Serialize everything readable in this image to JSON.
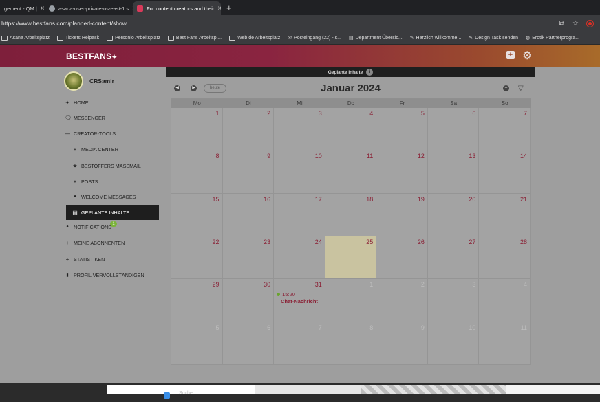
{
  "browser": {
    "tabs": [
      {
        "title": "gement - QM |",
        "color": "#6aa0ff"
      },
      {
        "title": "asana-user-private-us-east-1.s",
        "color": "#9aa0a6"
      },
      {
        "title": "For content creators and their",
        "color": "#d93a5a"
      }
    ],
    "url": "https://www.bestfans.com/planned-content/show",
    "bookmarks": [
      "Asana Arbeitsplatz",
      "Tickets Helpask",
      "Personio Arbeitsplatz",
      "Best Fans Arbeitspl...",
      "Web.de Arbeitsplatz",
      "Posteingang (22) - s...",
      "Department Übersic...",
      "Herzlich willkomme...",
      "Design Task senden",
      "Erotik Partnerprogra..."
    ]
  },
  "site": {
    "logo": "BESTFANS",
    "username": "CRSamir",
    "nav": [
      {
        "label": "HOME",
        "icon": "star-icon",
        "glyph": "✦"
      },
      {
        "label": "MESSENGER",
        "icon": "chat-icon",
        "glyph": "🗨"
      },
      {
        "label": "CREATOR-TOOLS",
        "icon": "minus-icon",
        "glyph": "—"
      },
      {
        "label": "MEDIA CENTER",
        "icon": "plus-icon",
        "glyph": "+"
      },
      {
        "label": "BESTOFFERS MASSMAIL",
        "icon": "star-icon",
        "glyph": "★"
      },
      {
        "label": "POSTS",
        "icon": "plus-icon",
        "glyph": "+"
      },
      {
        "label": "WELCOME MESSAGES",
        "icon": "speech-icon",
        "glyph": "●"
      },
      {
        "label": "GEPLANTE INHALTE",
        "icon": "calendar-icon",
        "glyph": "▤"
      },
      {
        "label": "NOTIFICATIONS",
        "icon": "bell-icon",
        "glyph": "●"
      },
      {
        "label": "MEINE ABONNENTEN",
        "icon": "plus-icon",
        "glyph": "+"
      },
      {
        "label": "STATISTIKEN",
        "icon": "plus-icon",
        "glyph": "+"
      },
      {
        "label": "PROFIL VERVOLLSTÄNDIGEN",
        "icon": "clipboard-icon",
        "glyph": "▮"
      }
    ],
    "notifications_badge": "1"
  },
  "calendar": {
    "section_title": "Geplante Inhalte",
    "section_count": "i",
    "today_label": "heute",
    "month_title": "Januar 2024",
    "weekdays": [
      "Mo",
      "Di",
      "Mi",
      "Do",
      "Fr",
      "Sa",
      "So"
    ],
    "days": [
      "1",
      "2",
      "3",
      "4",
      "5",
      "6",
      "7",
      "8",
      "9",
      "10",
      "11",
      "12",
      "13",
      "14",
      "15",
      "16",
      "17",
      "18",
      "19",
      "20",
      "21",
      "22",
      "23",
      "24",
      "25",
      "26",
      "27",
      "28",
      "29",
      "30",
      "31",
      "1",
      "2",
      "3",
      "4",
      "5",
      "6",
      "7",
      "8",
      "9",
      "10",
      "11"
    ],
    "other_month_from": 31,
    "today_index": 24,
    "event": {
      "day_index": 30,
      "time": "15:20",
      "title": "Chat-Nachricht"
    },
    "accent": "#8a1f34"
  },
  "taskbar": {
    "search_placeholder": "Suche"
  }
}
